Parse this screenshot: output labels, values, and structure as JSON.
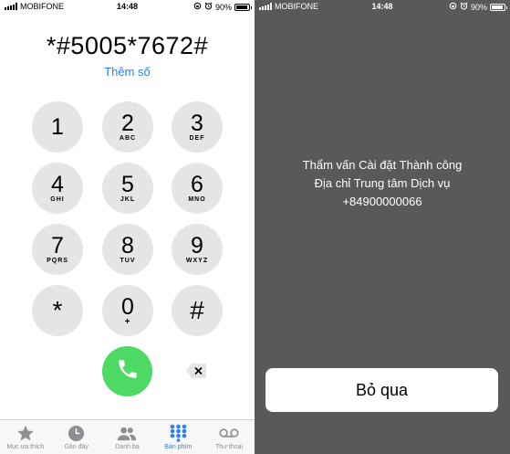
{
  "left_screen": {
    "status": {
      "carrier": "MOBIFONE",
      "time": "14:48",
      "battery": "90%",
      "battery_level": 0.9
    },
    "dialed_number": "*#5005*7672#",
    "add_number_link": "Thêm số",
    "keys": [
      {
        "digit": "1",
        "letters": ""
      },
      {
        "digit": "2",
        "letters": "ABC"
      },
      {
        "digit": "3",
        "letters": "DEF"
      },
      {
        "digit": "4",
        "letters": "GHI"
      },
      {
        "digit": "5",
        "letters": "JKL"
      },
      {
        "digit": "6",
        "letters": "MNO"
      },
      {
        "digit": "7",
        "letters": "PQRS"
      },
      {
        "digit": "8",
        "letters": "TUV"
      },
      {
        "digit": "9",
        "letters": "WXYZ"
      },
      {
        "digit": "*",
        "letters": ""
      },
      {
        "digit": "0",
        "letters": "+"
      },
      {
        "digit": "#",
        "letters": ""
      }
    ],
    "tabs": [
      {
        "label": "Mục ưa thích",
        "icon": "star-icon"
      },
      {
        "label": "Gần đây",
        "icon": "clock-icon"
      },
      {
        "label": "Danh bạ",
        "icon": "contacts-icon"
      },
      {
        "label": "Bàn phím",
        "icon": "keypad-icon",
        "active": true
      },
      {
        "label": "Thư thoại",
        "icon": "voicemail-icon"
      }
    ],
    "colors": {
      "accent": "#2f80ed",
      "call": "#4cd964",
      "key": "#e5e5e5"
    }
  },
  "right_screen": {
    "status": {
      "carrier": "MOBIFONE",
      "time": "14:48",
      "battery": "90%",
      "battery_level": 0.9
    },
    "message_lines": [
      "Thẩm vấn Cài đặt Thành công",
      "Địa chỉ Trung tâm Dịch vụ",
      "+84900000066"
    ],
    "dismiss_button": "Bỏ qua",
    "colors": {
      "background": "#595959"
    }
  }
}
